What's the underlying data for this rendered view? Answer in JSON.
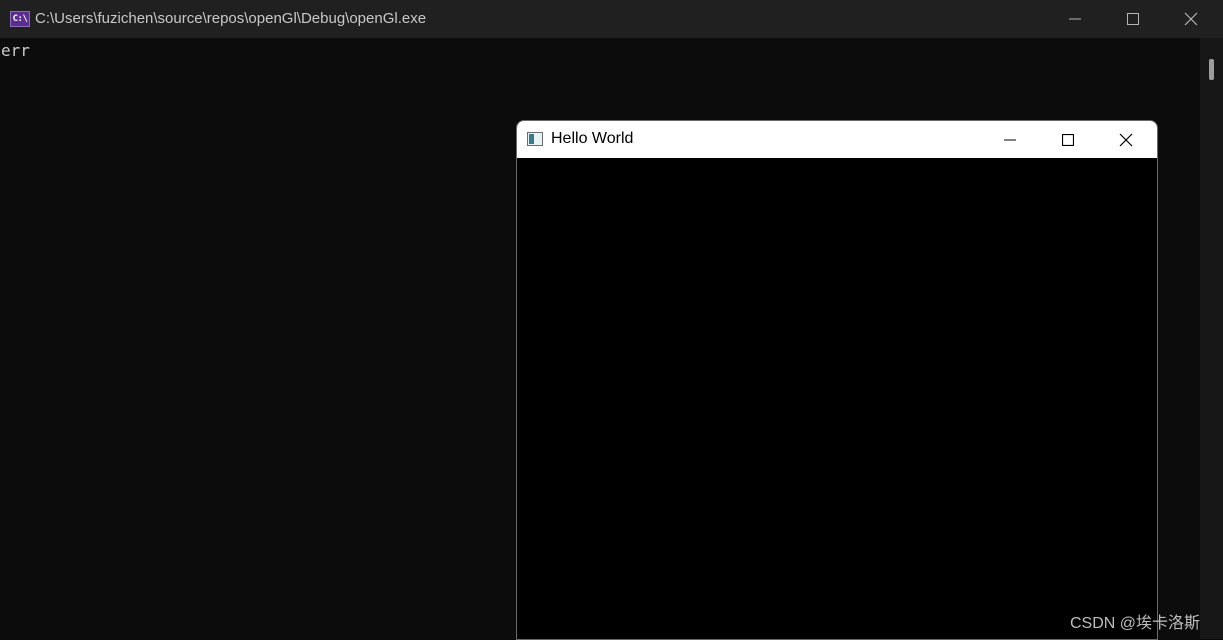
{
  "console": {
    "title": "C:\\Users\\fuzichen\\source\\repos\\openGl\\Debug\\openGl.exe",
    "icon_label": "C:\\",
    "output": "err"
  },
  "gl_window": {
    "title": "Hello World"
  },
  "watermark": "CSDN @埃卡洛斯"
}
